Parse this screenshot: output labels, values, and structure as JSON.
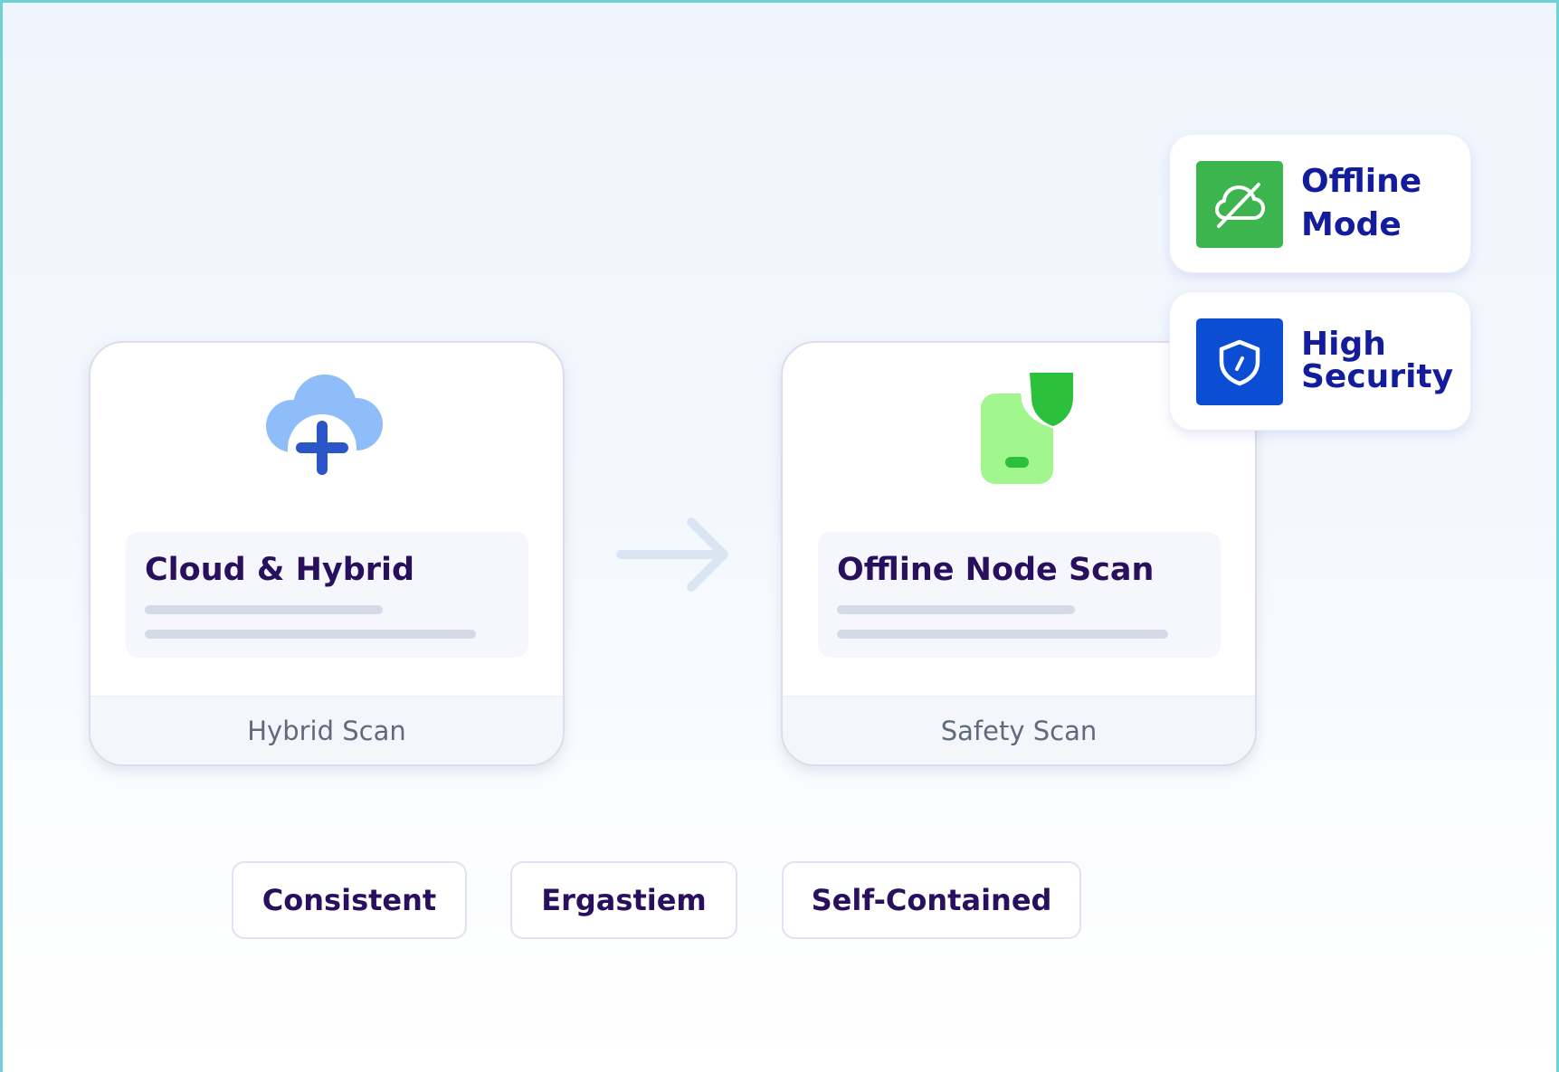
{
  "flow": {
    "source_card": {
      "title": "Cloud & Hybrid",
      "footer": "Hybrid Scan",
      "icon": "cloud-add-icon"
    },
    "target_card": {
      "title": "Offline Node Scan",
      "footer": "Safety Scan",
      "icon": "shielded-device-icon"
    },
    "connector_icon": "arrow-right-icon"
  },
  "badges": [
    {
      "line1": "Offline",
      "line2": "Mode",
      "icon": "cloud-off-icon",
      "color": "#3cb54f"
    },
    {
      "line1": "High",
      "line2": "Security",
      "icon": "shield-icon",
      "color": "#0b4ed3"
    }
  ],
  "tags": [
    "Consistent",
    "Ergastiem",
    "Self-Contained"
  ],
  "colors": {
    "title": "#28105e",
    "badge_text": "#131c9c",
    "frame": "#6fd0d6",
    "cloud_light": "#8fbdf9",
    "cloud_plus": "#2a56c8",
    "device": "#a1f78d",
    "shield": "#2cc13a"
  }
}
